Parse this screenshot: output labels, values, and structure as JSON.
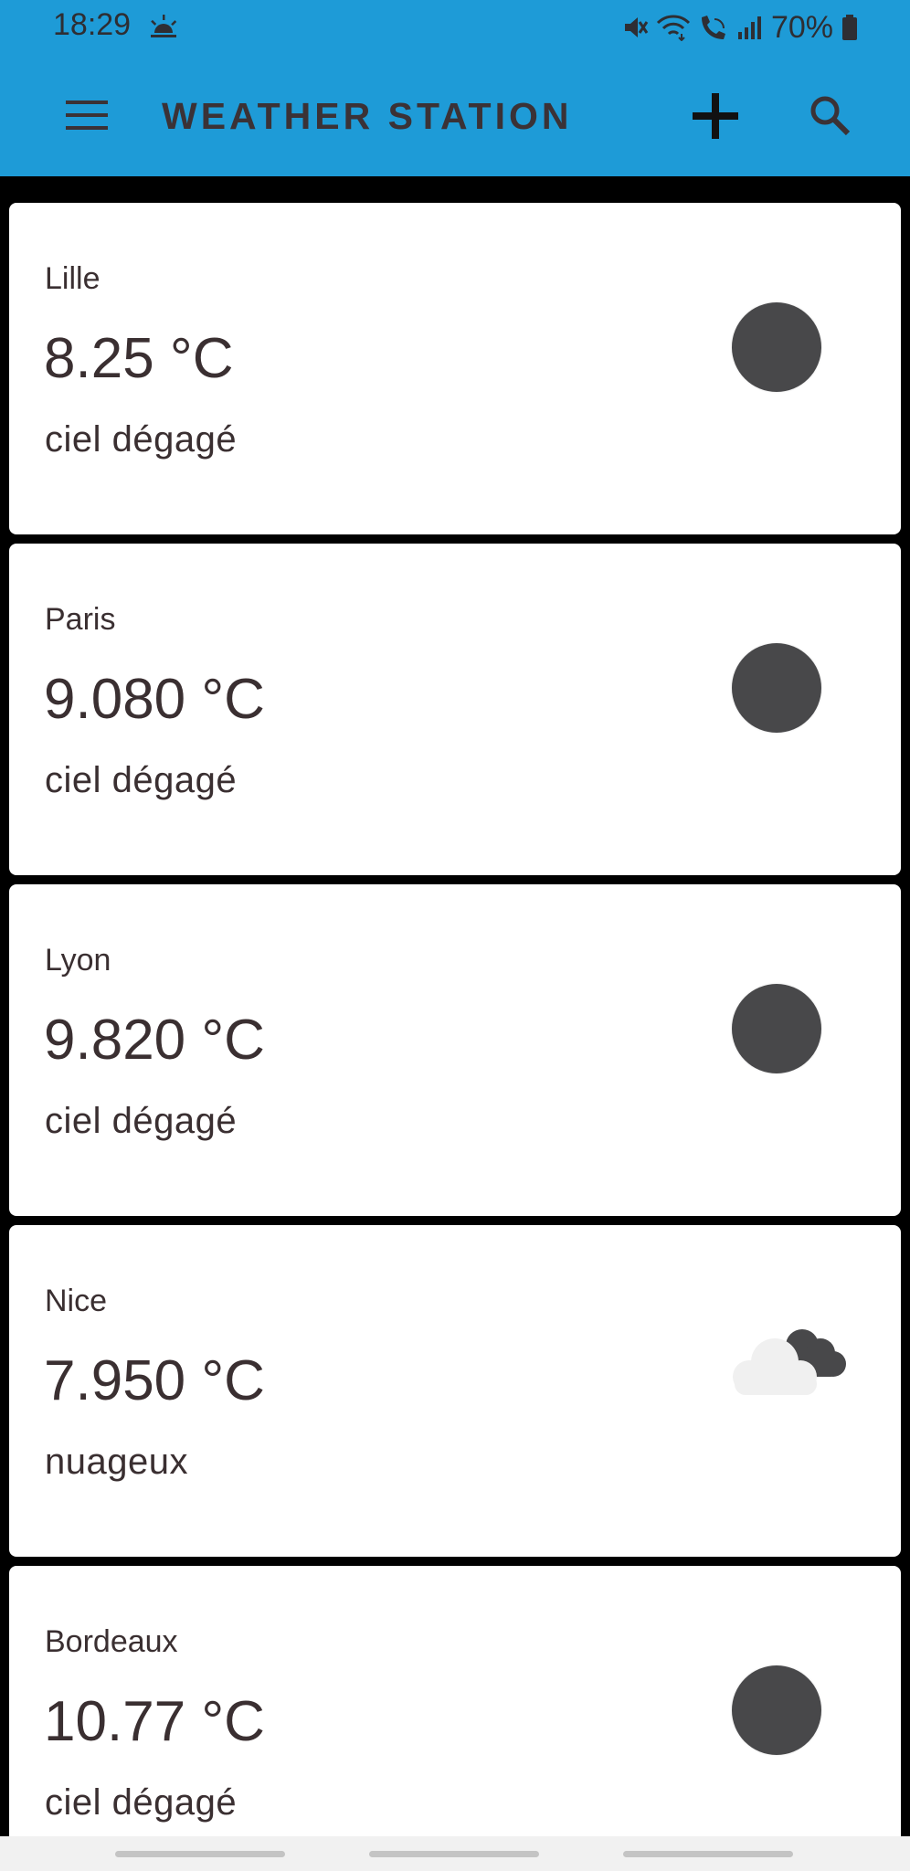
{
  "status_bar": {
    "time": "18:29",
    "weather_icon": "sunrise-icon",
    "battery": "70%",
    "icons": [
      "mute-icon",
      "wifi-icon",
      "wifi-call-icon",
      "signal-icon",
      "battery-icon"
    ]
  },
  "app_bar": {
    "title": "WEATHER STATION",
    "menu_icon": "menu-icon",
    "add_icon": "plus-icon",
    "search_icon": "search-icon",
    "background_color": "#1e9bd7"
  },
  "cities": [
    {
      "name": "Lille",
      "temperature": "8.25 °C",
      "description": "ciel dégagé",
      "icon": "clear-sky-icon"
    },
    {
      "name": "Paris",
      "temperature": "9.080 °C",
      "description": "ciel dégagé",
      "icon": "clear-sky-icon"
    },
    {
      "name": "Lyon",
      "temperature": "9.820 °C",
      "description": "ciel dégagé",
      "icon": "clear-sky-icon"
    },
    {
      "name": "Nice",
      "temperature": "7.950 °C",
      "description": "nuageux",
      "icon": "clouds-icon"
    },
    {
      "name": "Bordeaux",
      "temperature": "10.77 °C",
      "description": "ciel dégagé",
      "icon": "clear-sky-icon"
    }
  ]
}
